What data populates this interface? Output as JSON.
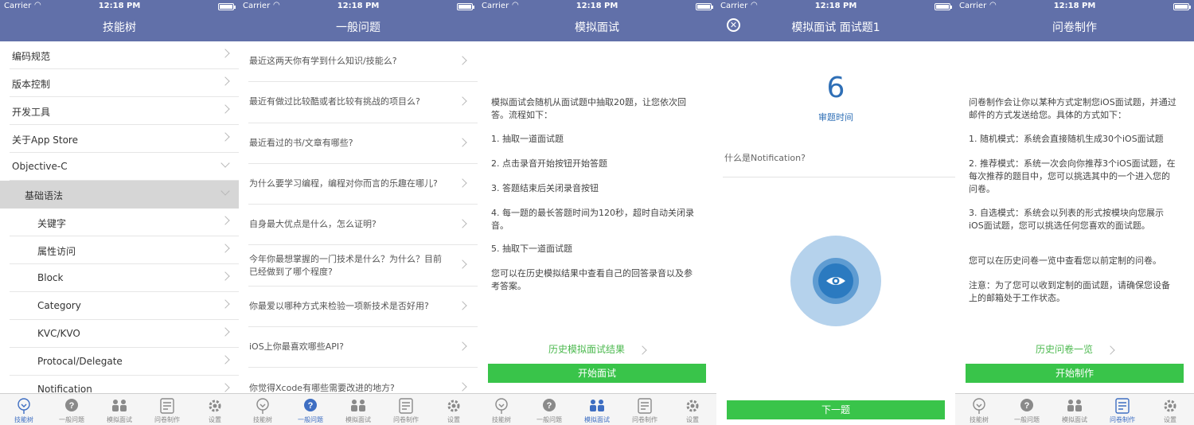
{
  "status": {
    "carrier": "Carrier",
    "time": "12:18 PM"
  },
  "tabs": [
    "技能树",
    "一般问题",
    "模拟面试",
    "问卷制作",
    "设置"
  ],
  "colors": {
    "nav": "#6170a9",
    "accent_green": "#39c44a",
    "active_tab": "#3e6ec2"
  },
  "screen1": {
    "title": "技能树",
    "active_tab": 0,
    "items": [
      {
        "label": "编码规范",
        "level": 0,
        "icon": "chevron-right"
      },
      {
        "label": "版本控制",
        "level": 0,
        "icon": "chevron-right"
      },
      {
        "label": "开发工具",
        "level": 0,
        "icon": "chevron-right"
      },
      {
        "label": "关于App Store",
        "level": 0,
        "icon": "chevron-right"
      },
      {
        "label": "Objective-C",
        "level": 0,
        "icon": "chevron-down"
      },
      {
        "label": "基础语法",
        "level": 1,
        "icon": "chevron-down"
      },
      {
        "label": "关键字",
        "level": 2,
        "icon": "chevron-right"
      },
      {
        "label": "属性访问",
        "level": 2,
        "icon": "chevron-right"
      },
      {
        "label": "Block",
        "level": 2,
        "icon": "chevron-right"
      },
      {
        "label": "Category",
        "level": 2,
        "icon": "chevron-right"
      },
      {
        "label": "KVC/KVO",
        "level": 2,
        "icon": "chevron-right"
      },
      {
        "label": "Protocal/Delegate",
        "level": 2,
        "icon": "chevron-right"
      },
      {
        "label": "Notification",
        "level": 2,
        "icon": "chevron-right"
      }
    ]
  },
  "screen2": {
    "title": "一般问题",
    "active_tab": 1,
    "questions": [
      "最近这两天你有学到什么知识/技能么?",
      "最近有做过比较酷或者比较有挑战的项目么?",
      "最近看过的书/文章有哪些?",
      "为什么要学习编程，编程对你而言的乐趣在哪儿?",
      "自身最大优点是什么，怎么证明?",
      "今年你最想掌握的一门技术是什么？为什么？目前已经做到了哪个程度?",
      "你最爱以哪种方式来检验一项新技术是否好用?",
      "iOS上你最喜欢哪些API?",
      "你觉得Xcode有哪些需要改进的地方?"
    ]
  },
  "screen3": {
    "title": "模拟面试",
    "active_tab": 2,
    "paragraphs": [
      "模拟面试会随机从面试题中抽取20题，让您依次回答。流程如下：",
      "1. 抽取一道面试题",
      "2. 点击录音开始按钮开始答题",
      "3. 答题结束后关闭录音按钮",
      "4. 每一题的最长答题时间为120秒，超时自动关闭录音。",
      "5. 抽取下一道面试题",
      "您可以在历史模拟结果中查看自己的回答录音以及参考答案。"
    ],
    "history_link": "历史模拟面试结果",
    "start_button": "开始面试"
  },
  "screen4": {
    "title": "模拟面试 面试题1",
    "timer_value": "6",
    "timer_label": "审题时间",
    "question": "什么是Notification?",
    "next_button": "下一题"
  },
  "screen5": {
    "title": "问卷制作",
    "active_tab": 3,
    "paragraphs": [
      "问卷制作会让你以某种方式定制您iOS面试题，并通过邮件的方式发送给您。具体的方式如下：",
      "1. 随机模式：系统会直接随机生成30个iOS面试题",
      "2. 推荐模式：系统一次会向你推荐3个iOS面试题，在每次推荐的题目中，您可以挑选其中的一个进入您的问卷。",
      "3. 自选模式：系统会以列表的形式按模块向您展示iOS面试题，您可以挑选任何您喜欢的面试题。",
      "您可以在历史问卷一览中查看您以前定制的问卷。",
      "注意：为了您可以收到定制的面试题，请确保您设备上的邮箱处于工作状态。"
    ],
    "history_link": "历史问卷一览",
    "start_button": "开始制作"
  }
}
